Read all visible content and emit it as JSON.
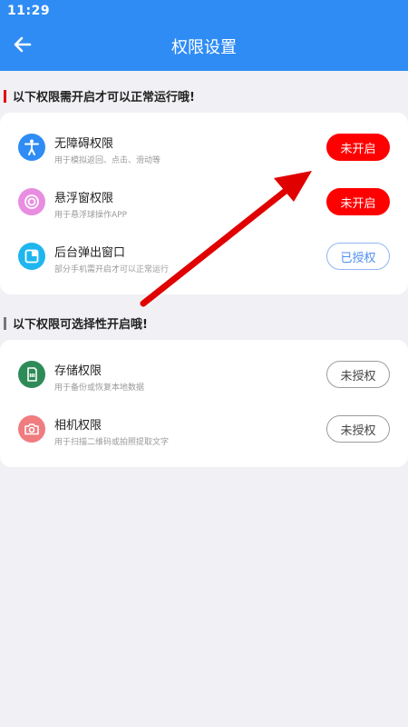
{
  "status_bar": {
    "time": "11:29"
  },
  "header": {
    "title": "权限设置"
  },
  "section1": {
    "title": "以下权限需开启才可以正常运行哦!",
    "items": [
      {
        "name": "无障碍权限",
        "desc": "用于模拟返回、点击、滑动等",
        "button": "未开启",
        "icon": "accessibility-icon"
      },
      {
        "name": "悬浮窗权限",
        "desc": "用于悬浮球操作APP",
        "button": "未开启",
        "icon": "floating-window-icon"
      },
      {
        "name": "后台弹出窗口",
        "desc": "部分手机需开启才可以正常运行",
        "button": "已授权",
        "icon": "popup-window-icon"
      }
    ]
  },
  "section2": {
    "title": "以下权限可选择性开启哦!",
    "items": [
      {
        "name": "存储权限",
        "desc": "用于备份或恢复本地数据",
        "button": "未授权",
        "icon": "storage-icon"
      },
      {
        "name": "相机权限",
        "desc": "用于扫描二维码或拍照提取文字",
        "button": "未授权",
        "icon": "camera-icon"
      }
    ]
  },
  "colors": {
    "primary": "#2f8cf4",
    "alert": "#ff0000",
    "granted": "#4f8ff0"
  }
}
